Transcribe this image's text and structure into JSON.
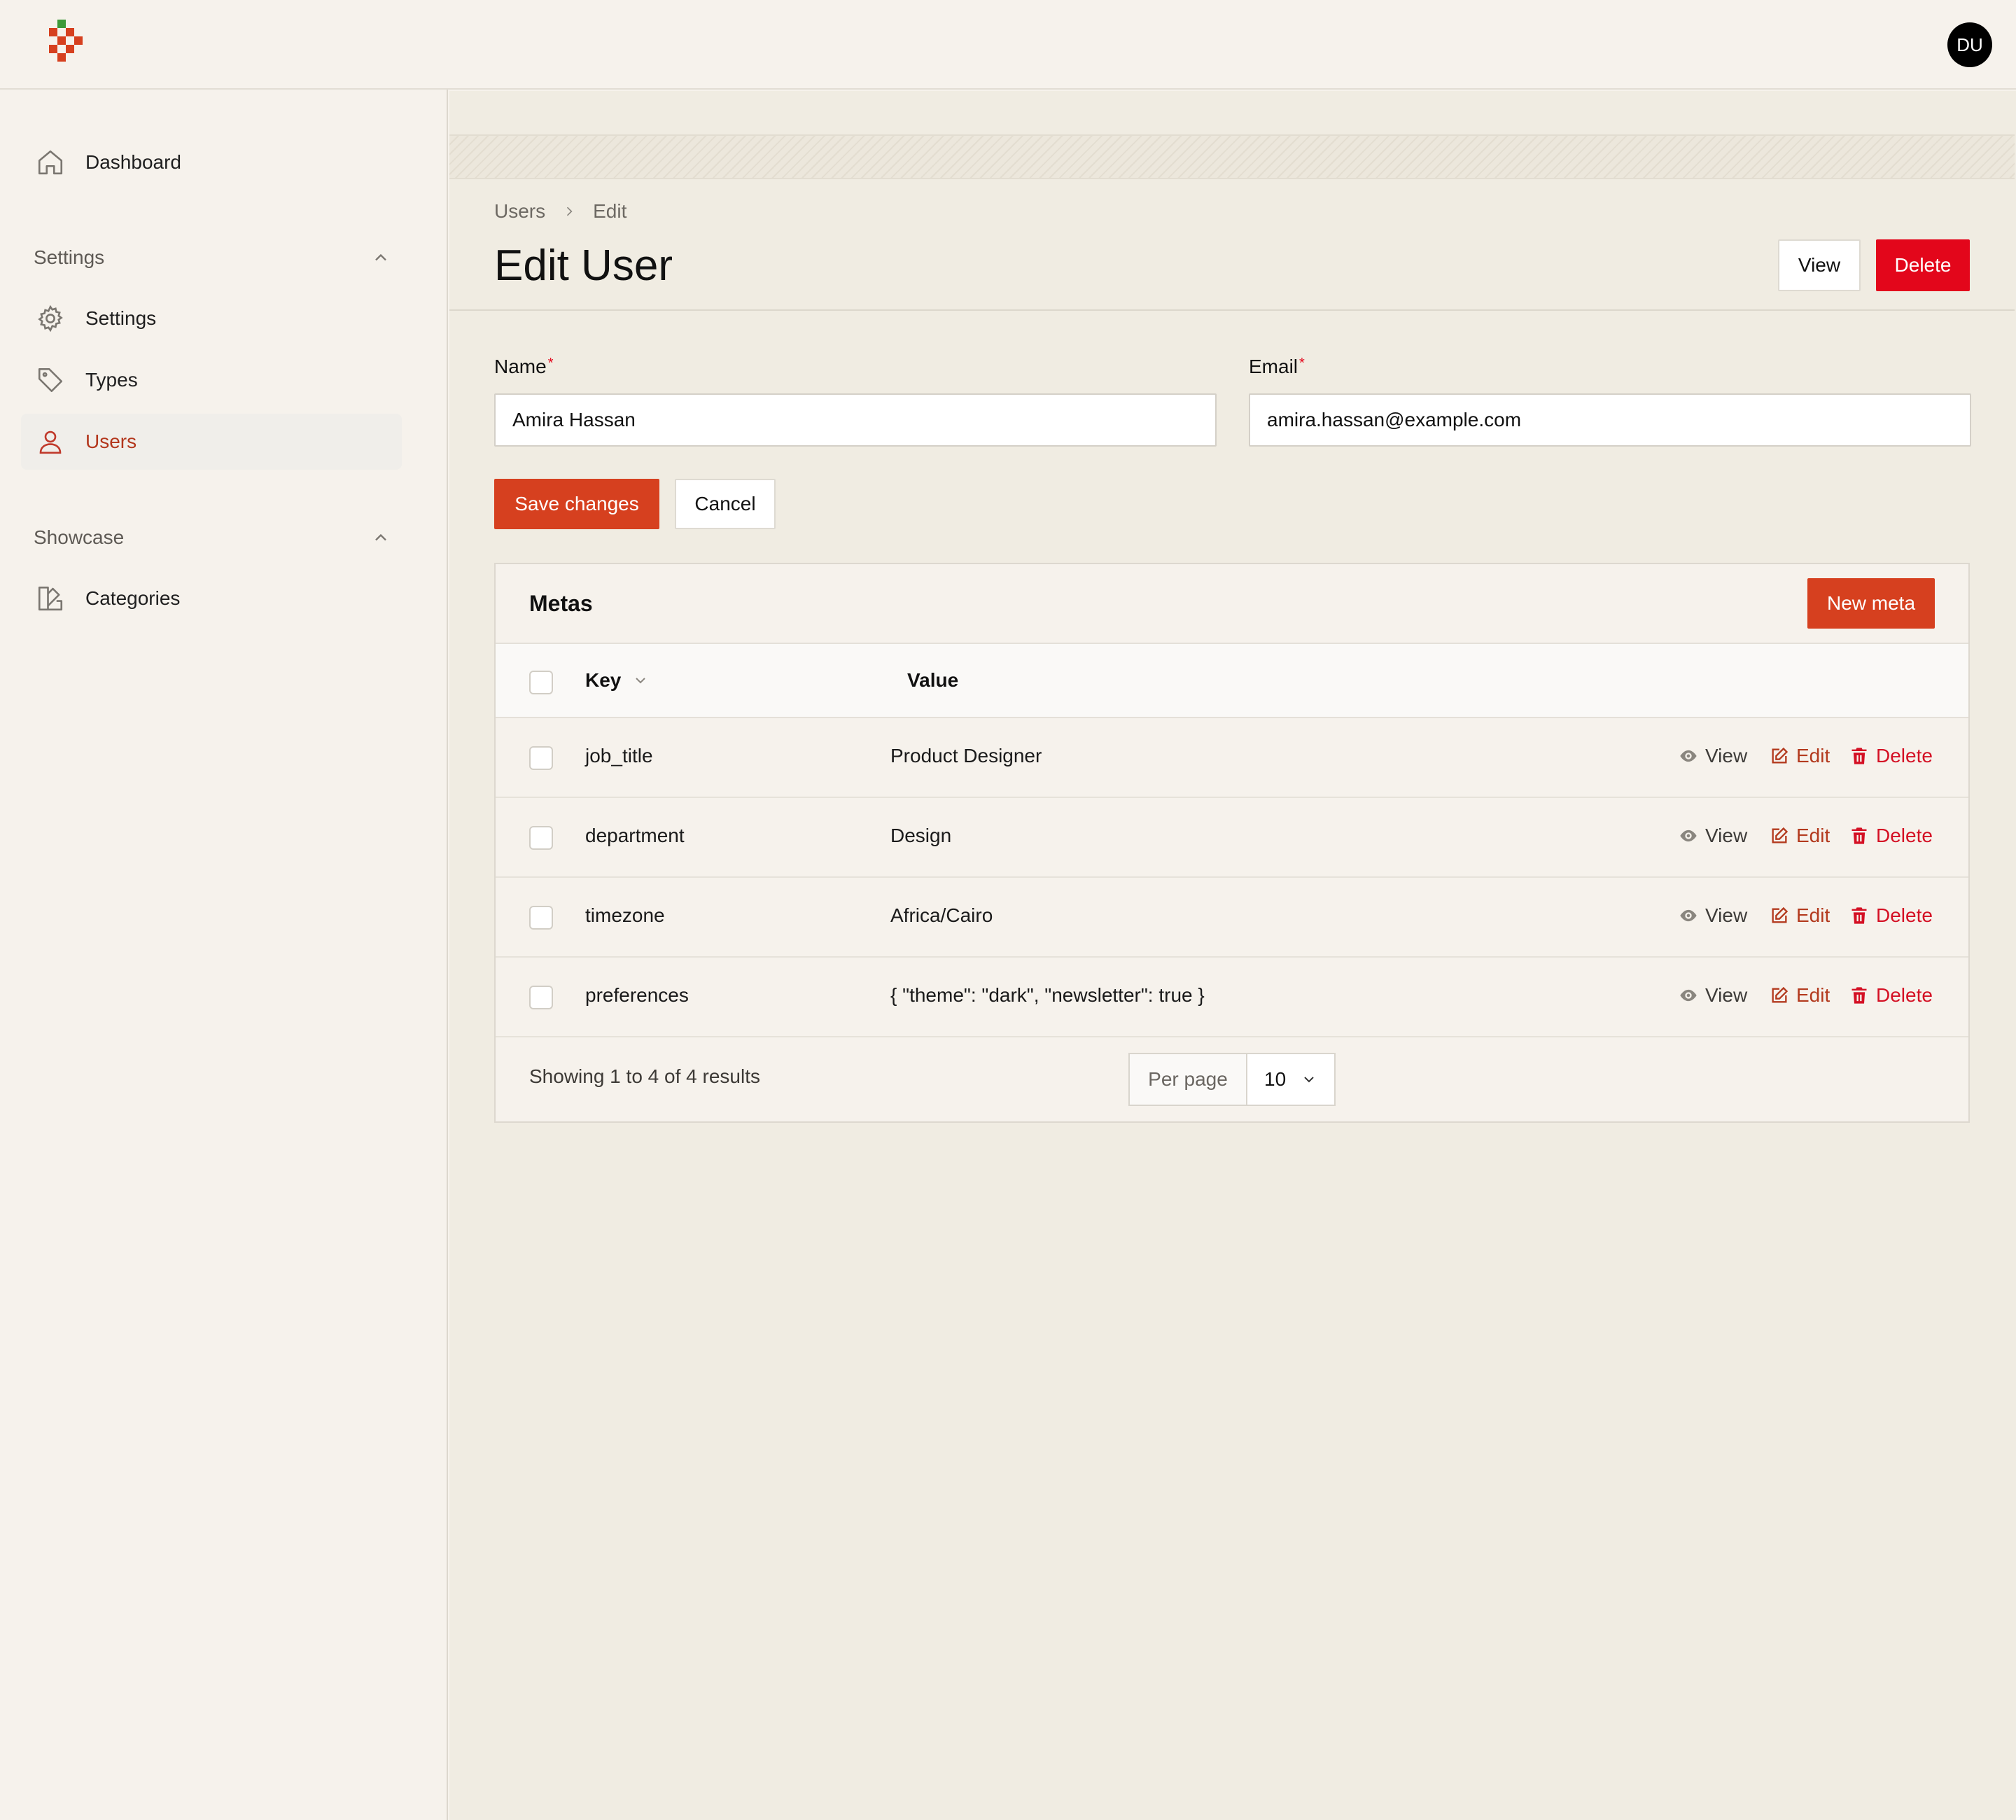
{
  "topbar": {
    "avatar_initials": "DU"
  },
  "sidebar": {
    "dashboard": "Dashboard",
    "groups": [
      {
        "label": "Settings",
        "items": [
          {
            "label": "Settings",
            "icon": "gear-icon"
          },
          {
            "label": "Types",
            "icon": "tag-icon"
          },
          {
            "label": "Users",
            "icon": "user-icon",
            "active": true
          }
        ]
      },
      {
        "label": "Showcase",
        "items": [
          {
            "label": "Categories",
            "icon": "swatch-icon"
          }
        ]
      }
    ]
  },
  "breadcrumb": {
    "items": [
      "Users",
      "Edit"
    ]
  },
  "page": {
    "title": "Edit User",
    "view_label": "View",
    "delete_label": "Delete"
  },
  "form": {
    "name_label": "Name",
    "name_value": "Amira Hassan",
    "email_label": "Email",
    "email_value": "amira.hassan@example.com",
    "required_mark": "*",
    "save_label": "Save changes",
    "cancel_label": "Cancel"
  },
  "metas": {
    "title": "Metas",
    "new_label": "New meta",
    "columns": {
      "key": "Key",
      "value": "Value"
    },
    "actions": {
      "view": "View",
      "edit": "Edit",
      "delete": "Delete"
    },
    "rows": [
      {
        "key": "job_title",
        "value": "Product Designer"
      },
      {
        "key": "department",
        "value": "Design"
      },
      {
        "key": "timezone",
        "value": "Africa/Cairo"
      },
      {
        "key": "preferences",
        "value": "{ \"theme\": \"dark\", \"newsletter\": true }"
      }
    ],
    "summary": "Showing 1 to 4 of 4 results",
    "per_page_label": "Per page",
    "per_page_value": "10"
  },
  "colors": {
    "accent": "#d6401f",
    "danger": "#e3061b",
    "active_nav": "#b3361c"
  }
}
